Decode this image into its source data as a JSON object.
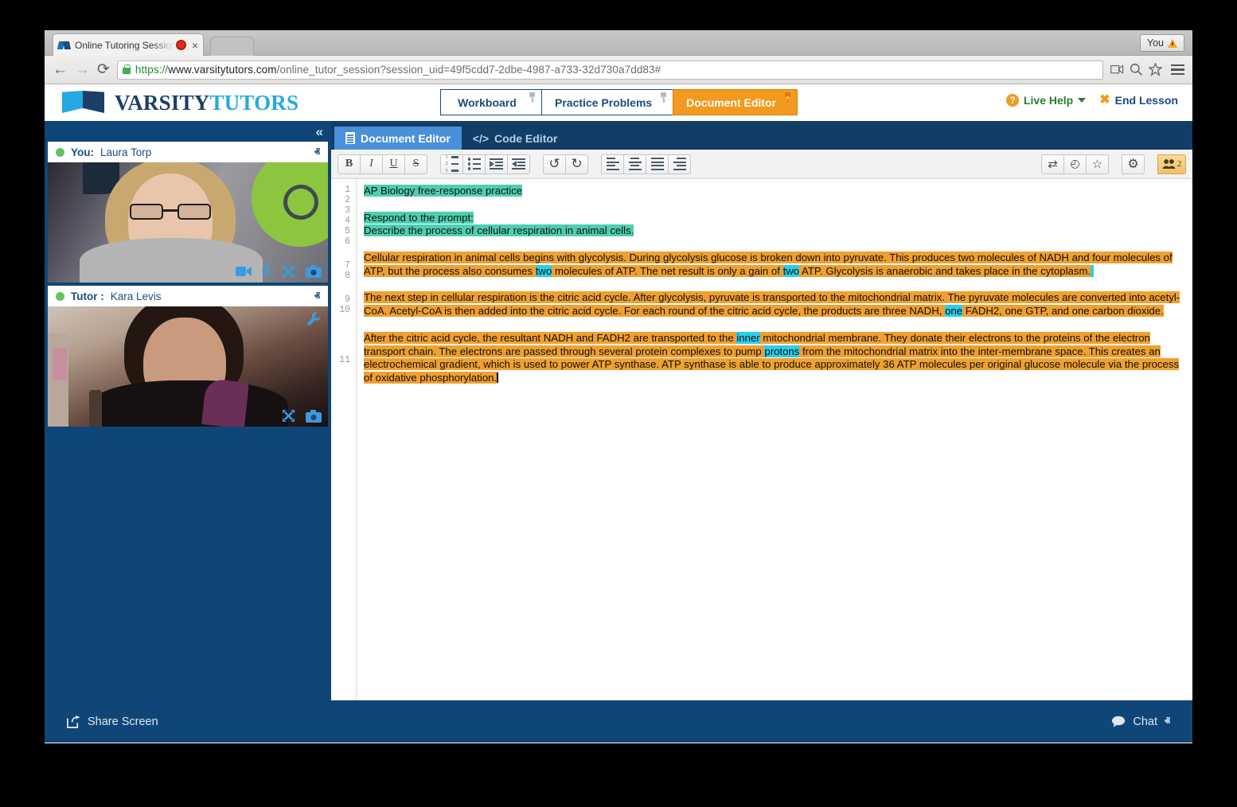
{
  "browser": {
    "tab_title": "Online Tutoring Session",
    "tab_close": "×",
    "you_badge": "You",
    "back_icon": "←",
    "forward_icon": "→",
    "reload_icon": "⟳",
    "url_scheme": "https",
    "url_sep": "://",
    "url_host": "www.varsitytutors.com",
    "url_path": "/online_tutor_session?session_uid=49f5cdd7-2dbe-4987-a733-32d730a7dd83#"
  },
  "header": {
    "brand_first": "VARSITY",
    "brand_second": "TUTORS",
    "tabs": [
      {
        "label": "Workboard",
        "active": false
      },
      {
        "label": "Practice Problems",
        "active": false
      },
      {
        "label": "Document Editor",
        "active": true
      }
    ],
    "live_help": "Live Help",
    "live_help_glyph": "?",
    "end_lesson": "End Lesson",
    "end_lesson_glyph": "✖"
  },
  "sidebar": {
    "collapse_glyph": "«",
    "panels": [
      {
        "role": "You:",
        "name": "Laura Torp",
        "chevron": "ⱏ",
        "icons": [
          "video-camera-icon",
          "microphone-icon",
          "fullscreen-icon",
          "snapshot-camera-icon"
        ]
      },
      {
        "role": "Tutor :",
        "name": "Kara Levis",
        "chevron": "ⱏ",
        "icons": [
          "fullscreen-icon",
          "snapshot-camera-icon"
        ],
        "wrench": "ὒ7"
      }
    ]
  },
  "editor": {
    "tabs": [
      {
        "label": "Document Editor",
        "active": true
      },
      {
        "label": "Code Editor",
        "active": false,
        "prefix": "</>"
      }
    ],
    "toolbar": {
      "bold": "B",
      "italic": "I",
      "underline": "U",
      "strike": "S",
      "ordered_list": "ordered-list-icon",
      "unordered_list": "unordered-list-icon",
      "indent": "indent-icon",
      "outdent": "outdent-icon",
      "undo": "↺",
      "redo": "↻",
      "align_left": "align-left-icon",
      "align_center": "align-center-icon",
      "align_justify": "align-justify-icon",
      "align_right": "align-right-icon",
      "swap": "⇄",
      "history": "◴",
      "star": "☆",
      "settings": "⚙",
      "participants_count": "2"
    },
    "line_numbers": [
      "1",
      "2",
      "3",
      "4",
      "5",
      "6",
      "7",
      "8",
      "9",
      "10",
      "11"
    ],
    "document": {
      "line1": "AP Biology free-response practice",
      "line3": "Respond to the prompt:",
      "line4": "Describe the process of cellular respiration in animal cells.",
      "para1_a": "Cellular respiration in animal cells begins with glycolysis. During glycolysis glucose is broken down into pyruvate. This produces two molecules of NADH and four molecules of ATP, but the process also consumes ",
      "para1_hl1": "two",
      "para1_b": " molecules of ATP. The net result is only a gain of ",
      "para1_hl2": "two",
      "para1_c": " ATP. Glycolysis is anaerobic and takes place in the cytoplasm.",
      "para2_a": "The next step in cellular respiration is the citric acid cycle. After glycolysis, pyruvate is transported to the mitochondrial matrix. The pyruvate molecules are converted into acetyl-CoA. Acetyl-CoA is then added into the citric acid cycle. For each round of the citric acid cycle, the products are three NADH, ",
      "para2_hl1": "one",
      "para2_b": " FADH2, one GTP, and one carbon dioxide.",
      "para3_a": "After the citric acid cycle, the resultant NADH and FADH2 are transported to the ",
      "para3_hl1": "inner",
      "para3_b": " mitochondrial membrane. They donate their electrons to the proteins of the electron transport chain. The electrons are passed through several protein complexes to pump ",
      "para3_hl2": "protons",
      "para3_c": " from the mitochondrial matrix into the inter-membrane space. This creates an electrochemical gradient, which is used to power ATP synthase. ATP synthase is able to produce approximately 36 ATP molecules per original glucose molecule via the process of oxidative phosphorylation."
    }
  },
  "footer": {
    "share_screen": "Share Screen",
    "share_icon": "↱",
    "chat": "Chat",
    "chat_icon": "💬",
    "chat_chevron": "ⱏ"
  },
  "colors": {
    "brand_dark": "#1b3f66",
    "brand_light": "#25a9e0",
    "panel_blue": "#0f4677",
    "accent_orange": "#f29a1f",
    "highlight_teal": "#4ecfb0",
    "highlight_orange": "#f0a030",
    "highlight_cyan": "#29d0e8",
    "tab_active_blue": "#4a90d9"
  }
}
